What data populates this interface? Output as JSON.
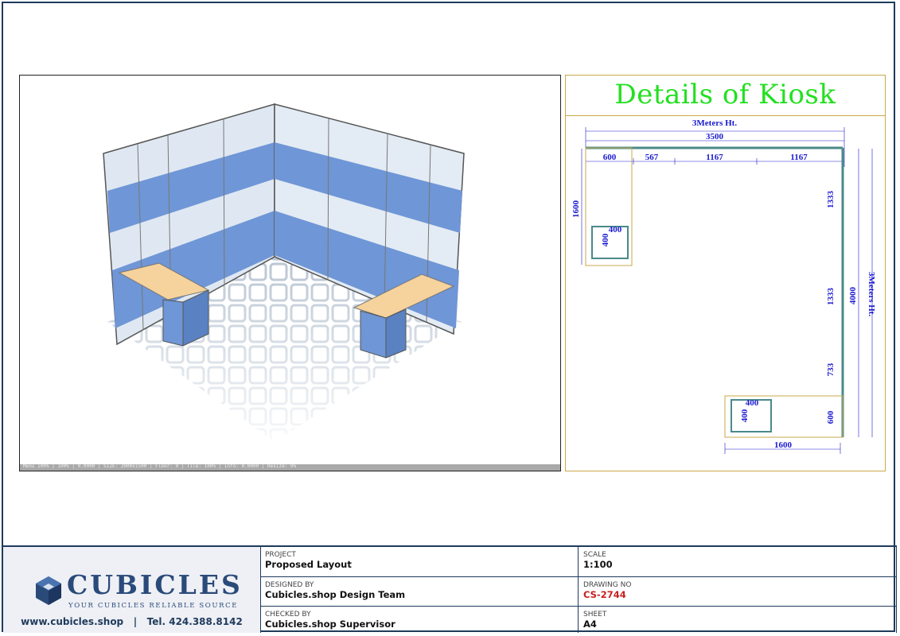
{
  "render": {
    "status_text": "Menu 100% | 100% | 0.0000 | SIZE: 2000x1500 | Floor: 0 | Tile: 100% | Info: 0.0000 | Resize: 0%"
  },
  "plan": {
    "title": "Details of Kiosk",
    "dimensions": {
      "top_height": "3Meters Ht.",
      "top_total": "3500",
      "top_seg_1": "600",
      "top_seg_2": "567",
      "top_seg_3": "1167",
      "top_seg_4": "1167",
      "left_depth": "1600",
      "desk1_w": "400",
      "desk1_h": "400",
      "right_seg_1": "1333",
      "right_seg_2": "1333",
      "right_seg_3": "733",
      "right_seg_4": "600",
      "right_total": "4000",
      "right_height": "3Meters Ht.",
      "desk2_w": "400",
      "desk2_h": "400",
      "bottom_width": "1600"
    },
    "colors": {
      "title": "#22e020",
      "dimension_text": "#1a1ad0",
      "wall": "#4a8a8a",
      "outline": "#c9a94a"
    }
  },
  "title_block": {
    "logo_word": "CUBICLES",
    "logo_tagline": "YOUR CUBICLES RELIABLE SOURCE",
    "website": "www.cubicles.shop",
    "separator": "|",
    "phone": "Tel. 424.388.8142",
    "project_label": "PROJECT",
    "project_value": "Proposed Layout",
    "scale_label": "SCALE",
    "scale_value": "1:100",
    "designed_label": "DESIGNED BY",
    "designed_value": "Cubicles.shop Design Team",
    "drawing_label": "DRAWING NO",
    "drawing_value": "CS-2744",
    "checked_label": "CHECKED BY",
    "checked_value": "Cubicles.shop Supervisor",
    "sheet_label": "SHEET",
    "sheet_value": "A4"
  }
}
